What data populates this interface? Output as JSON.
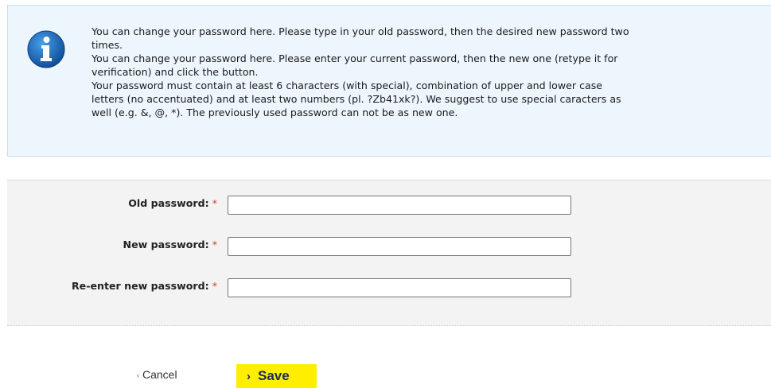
{
  "info": {
    "icon": "info-icon",
    "lines": [
      "You can change your password here. Please type in your old password, then the desired new password two",
      "times.",
      "You can change your password here. Please enter your current password, then the new one (retype it for",
      "verification) and click the button.",
      "Your password must contain at least 6 characters (with special), combination of upper and lower case",
      "letters (no accentuated) and at least two numbers (pl. ?Zb41xk?). We suggest to use special caracters as",
      "well (e.g. &, @, *). The previously used password can not be as new one."
    ]
  },
  "form": {
    "old_password_label": "Old password:",
    "new_password_label": "New password:",
    "reenter_password_label": "Re-enter new password:",
    "required_mark": "*",
    "old_password_value": "",
    "new_password_value": "",
    "reenter_password_value": ""
  },
  "actions": {
    "cancel_chevron": "‹",
    "cancel_label": "Cancel",
    "save_chevron": "›",
    "save_label": "Save"
  },
  "colors": {
    "info_background": "#eef6fd",
    "form_background": "#f4f3f3",
    "save_button": "#ffee00",
    "required": "#dd3333",
    "icon_blue": "#1565b8"
  }
}
